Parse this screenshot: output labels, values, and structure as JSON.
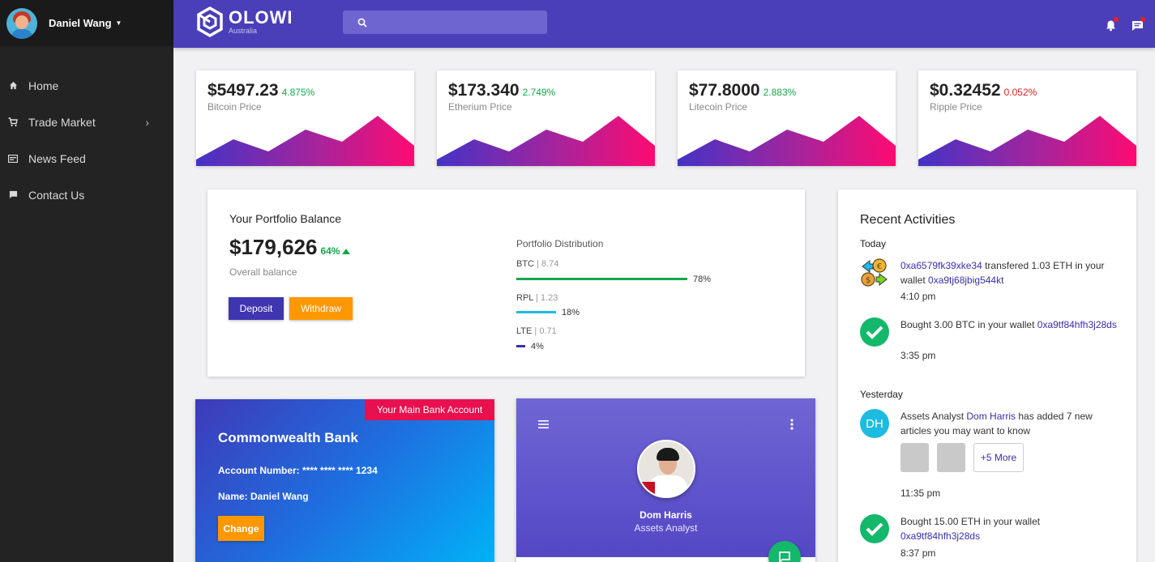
{
  "sidebar": {
    "user_name": "Daniel Wang",
    "items": [
      {
        "label": "Home",
        "icon": "home-icon"
      },
      {
        "label": "Trade Market",
        "icon": "cart-icon"
      },
      {
        "label": "News Feed",
        "icon": "newspaper-icon"
      },
      {
        "label": "Contact Us",
        "icon": "chat-icon"
      }
    ]
  },
  "header": {
    "brand": "OLOWI",
    "brand_sub": "Australia",
    "search_placeholder": ""
  },
  "prices": [
    {
      "value": "$5497.23",
      "change": "4.875%",
      "label": "Bitcoin Price",
      "negative": false
    },
    {
      "value": "$173.340",
      "change": "2.749%",
      "label": "Etherium Price",
      "negative": false
    },
    {
      "value": "$77.8000",
      "change": "2.883%",
      "label": "Litecoin Price",
      "negative": false
    },
    {
      "value": "$0.32452",
      "change": "0.052%",
      "label": "Ripple Price",
      "negative": true
    }
  ],
  "portfolio": {
    "title": "Your Portfolio Balance",
    "amount": "$179,626",
    "change": "64%",
    "sub": "Overall balance",
    "deposit": "Deposit",
    "withdraw": "Withdraw",
    "dist_title": "Portfolio Distribution",
    "distribution": [
      {
        "coin": "BTC",
        "amount": "8.74",
        "pct_label": "78%",
        "pct": 0.78,
        "color": "#13a84a"
      },
      {
        "coin": "RPL",
        "amount": "1.23",
        "pct_label": "18%",
        "pct": 0.18,
        "color": "#1ebbe0"
      },
      {
        "coin": "LTE",
        "amount": "0.71",
        "pct_label": "4%",
        "pct": 0.04,
        "color": "#3a2fa8"
      }
    ]
  },
  "activities": {
    "title": "Recent Activities",
    "today": "Today",
    "yesterday": "Yesterday",
    "a1": {
      "link1": "0xa6579fk39xke34",
      "text": " transfered 1.03 ETH in your wallet ",
      "link2": "0xa9tj68jbig544kt",
      "time": "4:10 pm"
    },
    "a2": {
      "text": "Bought 3.00 BTC in your wallet ",
      "link": "0xa9tf84hfh3j28ds",
      "time": "3:35 pm"
    },
    "a3": {
      "initials": "DH",
      "pre": "Assets Analyst ",
      "link": "Dom Harris",
      "post": " has added 7 new articles you may want to know",
      "more": "+5 More",
      "time": "11:35 pm"
    },
    "a4": {
      "text": "Bought 15.00 ETH in your wallet ",
      "link": "0xa9tf84hfh3j28ds",
      "time": "8:37 pm"
    }
  },
  "bank": {
    "tag": "Your Main Bank Account",
    "name": "Commonwealth Bank",
    "account": "Account Number: **** **** **** 1234",
    "holder": "Name: Daniel Wang",
    "change": "Change"
  },
  "profile": {
    "name": "Dom Harris",
    "role": "Assets Analyst"
  }
}
